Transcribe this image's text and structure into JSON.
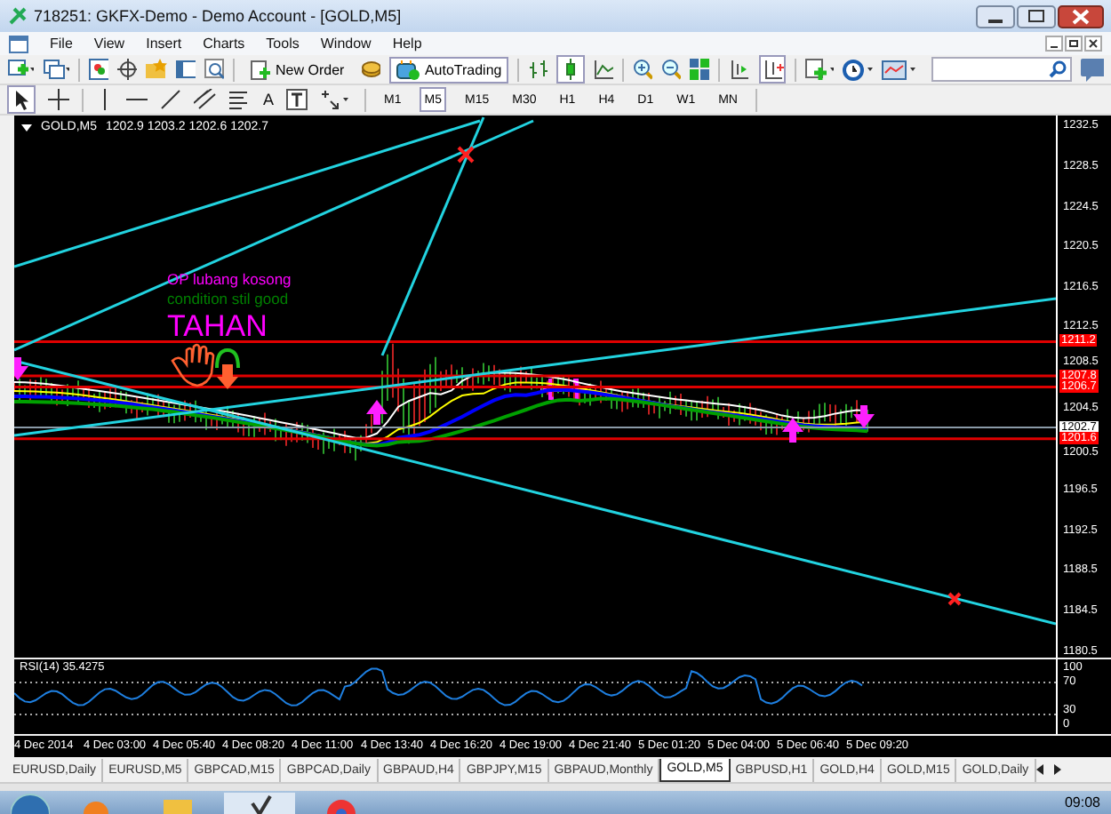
{
  "window": {
    "title": "718251: GKFX-Demo - Demo Account - [GOLD,M5]"
  },
  "menu": [
    "File",
    "View",
    "Insert",
    "Charts",
    "Tools",
    "Window",
    "Help"
  ],
  "toolbar": {
    "new_order": "New Order",
    "autotrading": "AutoTrading"
  },
  "drawing_tools": {
    "text_tool": "A"
  },
  "timeframes": [
    {
      "label": "M1",
      "selected": false
    },
    {
      "label": "M5",
      "selected": true
    },
    {
      "label": "M15",
      "selected": false
    },
    {
      "label": "M30",
      "selected": false
    },
    {
      "label": "H1",
      "selected": false
    },
    {
      "label": "H4",
      "selected": false
    },
    {
      "label": "D1",
      "selected": false
    },
    {
      "label": "W1",
      "selected": false
    },
    {
      "label": "MN",
      "selected": false
    }
  ],
  "chart": {
    "symbol": "GOLD,M5",
    "quote": "1202.9 1203.2 1202.6 1202.7",
    "annotations": [
      {
        "text": "OP lubang kosong",
        "color": "#ff00ff",
        "kind": "small"
      },
      {
        "text": "condition stil good",
        "color": "#008000",
        "kind": "small"
      },
      {
        "text": "TAHAN",
        "color": "#ff00ff",
        "kind": "large"
      }
    ],
    "price_axis": [
      "1232.5",
      "1228.5",
      "1224.5",
      "1220.5",
      "1216.5",
      "1212.5",
      "1208.5",
      "1204.5",
      "1200.5",
      "1196.5",
      "1192.5",
      "1188.5",
      "1184.5",
      "1180.5"
    ],
    "price_tags": [
      {
        "text": "1211.2",
        "color": "#ff0000"
      },
      {
        "text": "1207.8",
        "color": "#ff0000"
      },
      {
        "text": "1206.7",
        "color": "#ff0000"
      },
      {
        "text": "1202.7",
        "color": "#ffffff"
      },
      {
        "text": "1201.6",
        "color": "#ff0000"
      }
    ],
    "rsi": {
      "label": "RSI(14) 35.4275",
      "axis": [
        "100",
        "70",
        "30",
        "0"
      ]
    },
    "time_axis": [
      "4 Dec 2014",
      "4 Dec 03:00",
      "4 Dec 05:40",
      "4 Dec 08:20",
      "4 Dec 11:00",
      "4 Dec 13:40",
      "4 Dec 16:20",
      "4 Dec 19:00",
      "4 Dec 21:40",
      "5 Dec 01:20",
      "5 Dec 04:00",
      "5 Dec 06:40",
      "5 Dec 09:20"
    ]
  },
  "tabs": [
    {
      "label": "EURUSD,Daily",
      "selected": false
    },
    {
      "label": "EURUSD,M5",
      "selected": false
    },
    {
      "label": "GBPCAD,M15",
      "selected": false
    },
    {
      "label": "GBPCAD,Daily",
      "selected": false
    },
    {
      "label": "GBPAUD,H4",
      "selected": false
    },
    {
      "label": "GBPJPY,M15",
      "selected": false
    },
    {
      "label": "GBPAUD,Monthly",
      "selected": false
    },
    {
      "label": "GOLD,M5",
      "selected": true
    },
    {
      "label": "GBPUSD,H1",
      "selected": false
    },
    {
      "label": "GOLD,H4",
      "selected": false
    },
    {
      "label": "GOLD,M15",
      "selected": false
    },
    {
      "label": "GOLD,Daily",
      "selected": false
    }
  ],
  "taskbar": {
    "clock": "09:08"
  }
}
